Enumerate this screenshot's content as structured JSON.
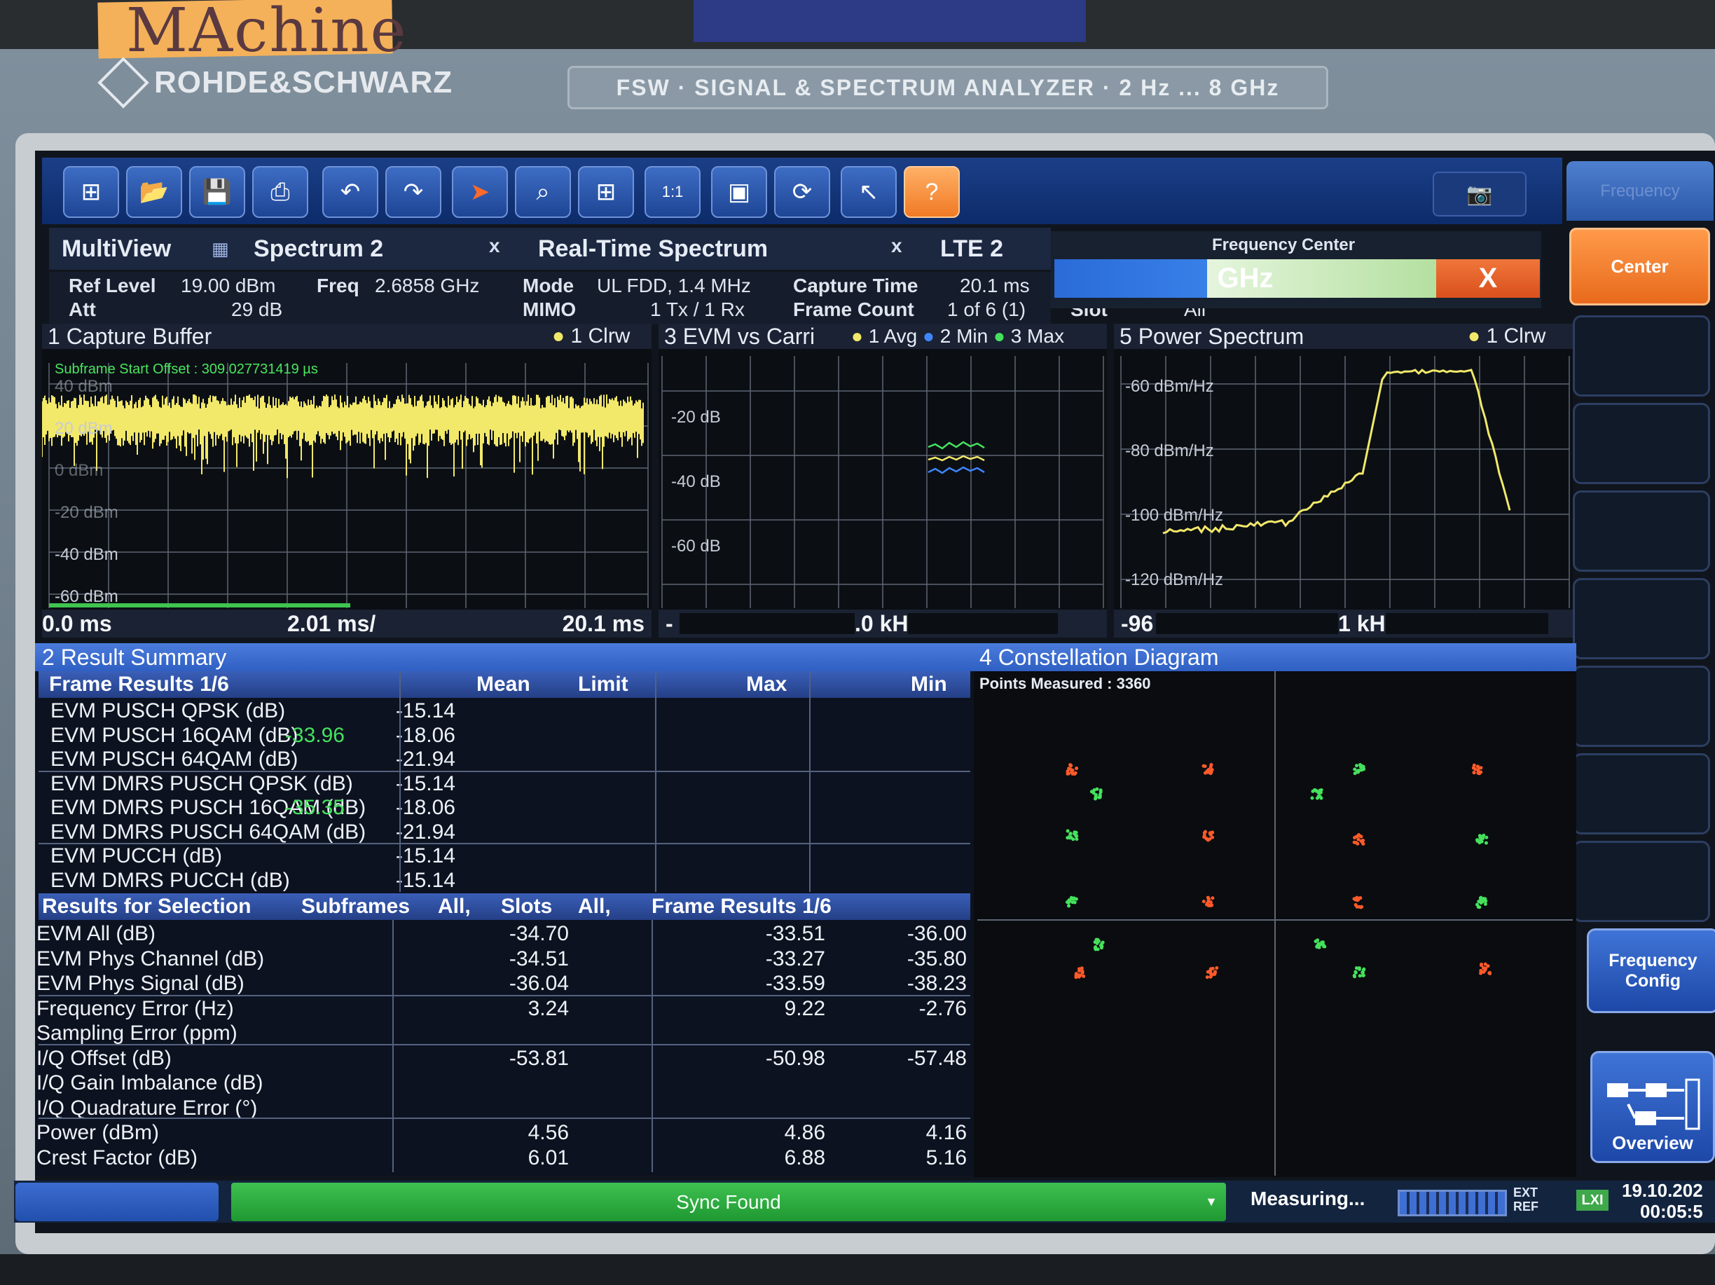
{
  "device": {
    "brand": "ROHDE&SCHWARZ",
    "model_banner": "FSW · SIGNAL & SPECTRUM ANALYZER · 2 Hz ... 8 GHz",
    "sticky_note": "MAchine"
  },
  "toolbar": {
    "icons": [
      "windows-icon",
      "open-folder-icon",
      "save-icon",
      "print-icon",
      "undo-icon",
      "redo-icon",
      "pointer-icon",
      "zoom-icon",
      "multi-zoom-icon",
      "zoom-1to1-icon",
      "display-icon",
      "sequencer-icon",
      "whats-this-icon",
      "help-icon"
    ],
    "help_glyph": "?",
    "camera_glyph": "📷"
  },
  "softkeys": {
    "top_label": "Frequency",
    "center": "Center",
    "frequency_config": "Frequency Config",
    "overview": "Overview"
  },
  "tabs": {
    "multiview": "MultiView",
    "spectrum2": "Spectrum 2",
    "rts": "Real-Time Spectrum",
    "lte2": "LTE 2",
    "close": "x"
  },
  "info": {
    "ref_level_label": "Ref Level",
    "ref_level_value": "19.00 dBm",
    "freq_label": "Freq",
    "freq_value": "2.6858 GHz",
    "att_label": "Att",
    "att_value": "29 dB",
    "mode_label": "Mode",
    "mode_value": "UL FDD, 1.4 MHz",
    "mimo_label": "MIMO",
    "mimo_value": "1 Tx / 1 Rx",
    "capture_time_label": "Capture Time",
    "capture_time_value": "20.1 ms",
    "frame_count_label": "Frame Count",
    "frame_count_value": "1 of 6 (1)",
    "slot_label": "Slot",
    "slot_value": "All"
  },
  "freq_editor": {
    "label": "Frequency Center",
    "unit": "GHz",
    "close": "X"
  },
  "pane1": {
    "title": "1 Capture Buffer",
    "trace": "1 Clrw",
    "offset_note": "Subframe Start Offset : 309.027731419 µs",
    "y_ticks": [
      "40 dBm",
      "20 dBm",
      "0 dBm",
      "-20 dBm",
      "-40 dBm",
      "-60 dBm"
    ],
    "x_start": "0.0 ms",
    "x_div": "2.01 ms/",
    "x_end": "20.1 ms"
  },
  "pane3": {
    "title": "3 EVM vs Carri",
    "traces": [
      "1 Avg",
      "2 Min",
      "3 Max"
    ],
    "y_ticks": [
      "-20 dB",
      "-40 dB",
      "-60 dB"
    ],
    "x_axis": ".0 kH"
  },
  "pane5": {
    "title": "5 Power Spectrum",
    "trace": "1 Clrw",
    "y_ticks": [
      "-60 dBm/Hz",
      "-80 dBm/Hz",
      "-100 dBm/Hz",
      "-120 dBm/Hz"
    ],
    "x_left": "-96",
    "x_mid": "1 kH"
  },
  "result_summary": {
    "title": "2 Result Summary",
    "frame_header": {
      "name": "Frame Results 1/6",
      "mean": "Mean",
      "limit": "Limit",
      "max": "Max",
      "min": "Min"
    },
    "frame_rows": [
      {
        "name": "EVM PUSCH QPSK (dB)",
        "mean": "",
        "limit": "-15.14"
      },
      {
        "name": "EVM PUSCH 16QAM (dB)",
        "mean": "-33.96",
        "limit": "-18.06"
      },
      {
        "name": "EVM PUSCH 64QAM (dB)",
        "mean": "",
        "limit": "-21.94"
      },
      {
        "name": "EVM DMRS PUSCH QPSK (dB)",
        "mean": "",
        "limit": "-15.14"
      },
      {
        "name": "EVM DMRS PUSCH 16QAM (dB)",
        "mean": "-35.35",
        "limit": "-18.06"
      },
      {
        "name": "EVM DMRS PUSCH 64QAM (dB)",
        "mean": "",
        "limit": "-21.94"
      },
      {
        "name": "EVM PUCCH (dB)",
        "mean": "",
        "limit": "-15.14"
      },
      {
        "name": "EVM DMRS PUCCH (dB)",
        "mean": "",
        "limit": "-15.14"
      }
    ],
    "selection_header": {
      "name": "Results for Selection",
      "subframes": "Subframes",
      "subframes_val": "All,",
      "slots": "Slots",
      "slots_val": "All,",
      "frame": "Frame Results 1/6"
    },
    "selection_rows": [
      {
        "name": "EVM All (dB)",
        "mean": "-34.70",
        "max": "-33.51",
        "min": "-36.00"
      },
      {
        "name": "EVM Phys Channel (dB)",
        "mean": "-34.51",
        "max": "-33.27",
        "min": "-35.80"
      },
      {
        "name": "EVM Phys Signal (dB)",
        "mean": "-36.04",
        "max": "-33.59",
        "min": "-38.23"
      },
      {
        "name": "Frequency Error (Hz)",
        "mean": "3.24",
        "max": "9.22",
        "min": "-2.76"
      },
      {
        "name": "Sampling Error (ppm)",
        "mean": "",
        "max": "",
        "min": ""
      },
      {
        "name": "I/Q Offset (dB)",
        "mean": "-53.81",
        "max": "-50.98",
        "min": "-57.48"
      },
      {
        "name": "I/Q Gain Imbalance (dB)",
        "mean": "",
        "max": "",
        "min": ""
      },
      {
        "name": "I/Q Quadrature Error (°)",
        "mean": "",
        "max": "",
        "min": ""
      },
      {
        "name": "Power (dBm)",
        "mean": "4.56",
        "max": "4.86",
        "min": "4.16"
      },
      {
        "name": "Crest Factor (dB)",
        "mean": "6.01",
        "max": "6.88",
        "min": "5.16"
      }
    ]
  },
  "constellation": {
    "title": "4 Constellation Diagram",
    "points_measured": "Points Measured : 3360"
  },
  "status": {
    "sync": "Sync Found",
    "measuring": "Measuring...",
    "ext_ref": "EXT\nREF",
    "lxi": "LXI",
    "date": "19.10.202",
    "time": "00:05:5"
  },
  "colors": {
    "trace_yellow": "#f2e86a",
    "mean_green": "#45e15d",
    "accent_orange": "#f07a25",
    "panel_blue": "#2f5fc2"
  }
}
